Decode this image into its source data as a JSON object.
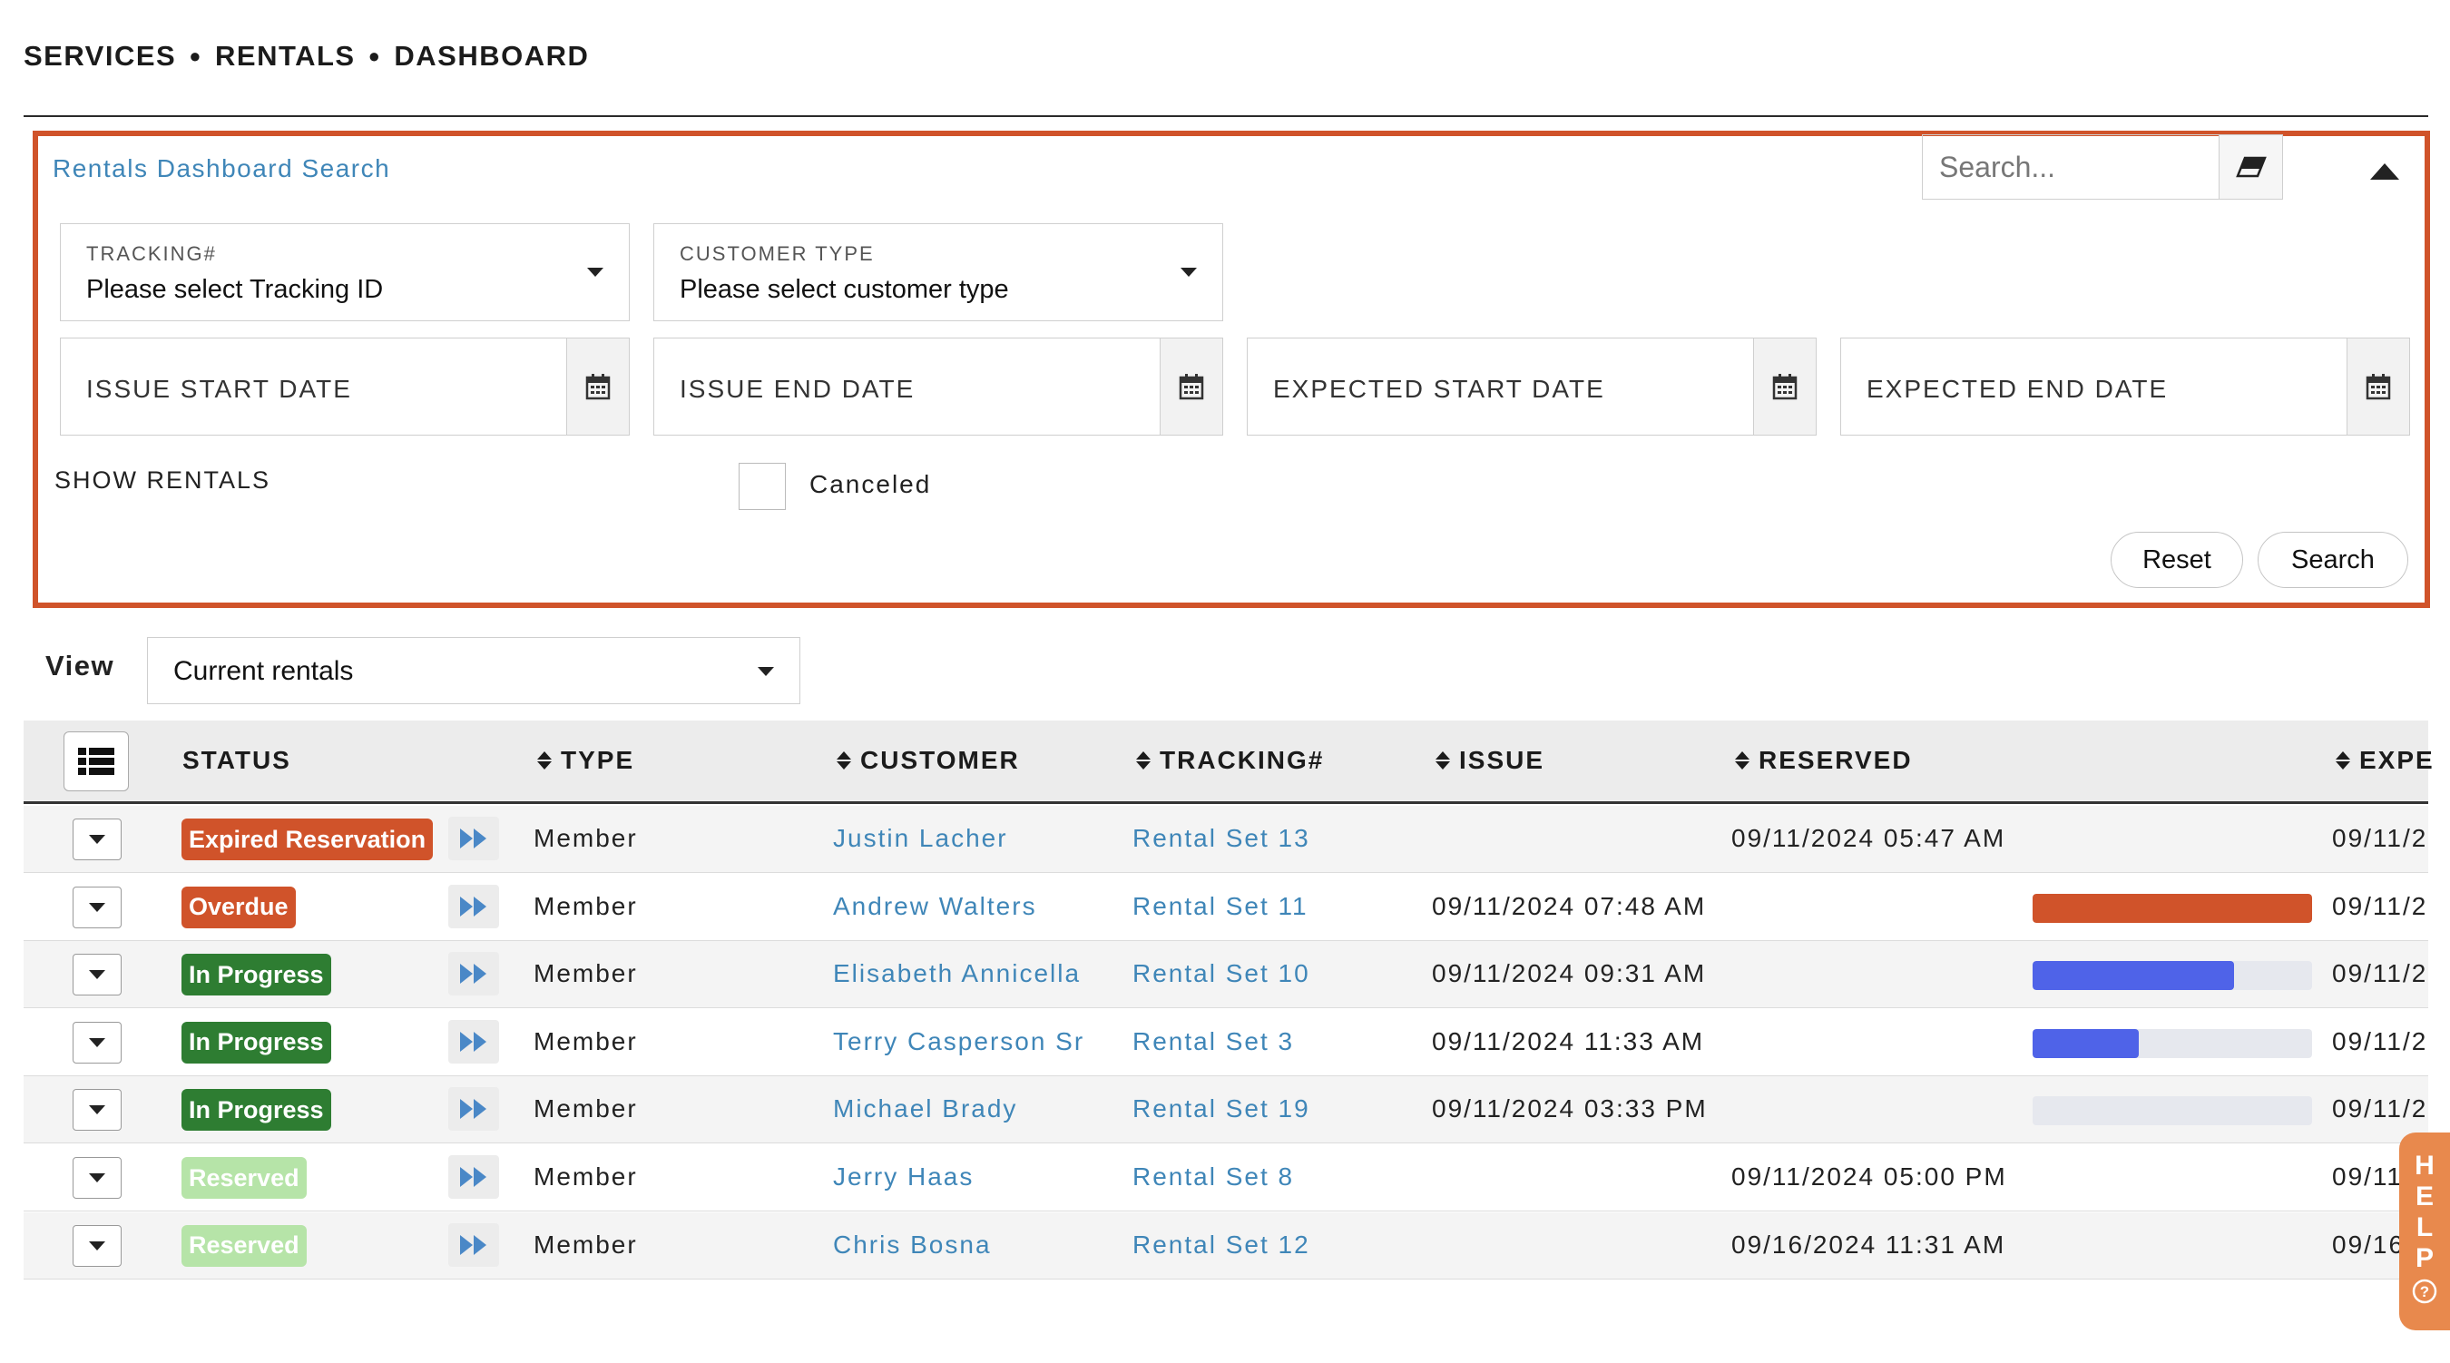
{
  "breadcrumb": {
    "items": [
      "SERVICES",
      "RENTALS",
      "DASHBOARD"
    ],
    "separator": "●"
  },
  "search_panel": {
    "title": "Rentals Dashboard Search",
    "search_placeholder": "Search...",
    "tracking": {
      "label": "TRACKING#",
      "placeholder": "Please select Tracking ID"
    },
    "customer_type": {
      "label": "CUSTOMER TYPE",
      "placeholder": "Please select customer type"
    },
    "dates": {
      "issue_start": "ISSUE START DATE",
      "issue_end": "ISSUE END DATE",
      "expected_start": "EXPECTED START DATE",
      "expected_end": "EXPECTED END DATE"
    },
    "show_rentals_label": "SHOW RENTALS",
    "canceled_label": "Canceled",
    "reset_label": "Reset",
    "search_label": "Search",
    "highlight_color": "#d0532a"
  },
  "view": {
    "label": "View",
    "selected": "Current rentals"
  },
  "table": {
    "columns": {
      "status": "STATUS",
      "type": "TYPE",
      "customer": "CUSTOMER",
      "tracking": "TRACKING#",
      "issue": "ISSUE",
      "reserved": "RESERVED",
      "expected": "EXPE"
    },
    "rows": [
      {
        "status": "Expired Reservation",
        "status_color": "#d0532a",
        "type": "Member",
        "customer": "Justin Lacher",
        "tracking": "Rental Set 13",
        "issue": "",
        "reserved": "09/11/2024 05:47 AM",
        "expected": "09/11/2",
        "progress": null,
        "progress_color": ""
      },
      {
        "status": "Overdue",
        "status_color": "#d0532a",
        "type": "Member",
        "customer": "Andrew Walters",
        "tracking": "Rental Set 11",
        "issue": "09/11/2024 07:48 AM",
        "reserved": "",
        "expected": "09/11/2",
        "progress": 1.0,
        "progress_color": "#d0532a"
      },
      {
        "status": "In Progress",
        "status_color": "#2e7d32",
        "type": "Member",
        "customer": "Elisabeth Annicella",
        "tracking": "Rental Set 10",
        "issue": "09/11/2024 09:31 AM",
        "reserved": "",
        "expected": "09/11/2",
        "progress": 0.72,
        "progress_color": "#4f63e8"
      },
      {
        "status": "In Progress",
        "status_color": "#2e7d32",
        "type": "Member",
        "customer": "Terry Casperson Sr",
        "tracking": "Rental Set 3",
        "issue": "09/11/2024 11:33 AM",
        "reserved": "",
        "expected": "09/11/2",
        "progress": 0.38,
        "progress_color": "#4f63e8"
      },
      {
        "status": "In Progress",
        "status_color": "#2e7d32",
        "type": "Member",
        "customer": "Michael Brady",
        "tracking": "Rental Set 19",
        "issue": "09/11/2024 03:33 PM",
        "reserved": "",
        "expected": "09/11/2",
        "progress": 0.0,
        "progress_color": "#4f63e8"
      },
      {
        "status": "Reserved",
        "status_color": "#b6e4a8",
        "type": "Member",
        "customer": "Jerry Haas",
        "tracking": "Rental Set 8",
        "issue": "",
        "reserved": "09/11/2024 05:00 PM",
        "expected": "09/11",
        "progress": null,
        "progress_color": ""
      },
      {
        "status": "Reserved",
        "status_color": "#b6e4a8",
        "type": "Member",
        "customer": "Chris Bosna",
        "tracking": "Rental Set 12",
        "issue": "",
        "reserved": "09/16/2024 11:31 AM",
        "expected": "09/16",
        "progress": null,
        "progress_color": ""
      }
    ]
  },
  "help": {
    "letters": [
      "H",
      "E",
      "L",
      "P"
    ],
    "icon": "question-circle-icon"
  }
}
